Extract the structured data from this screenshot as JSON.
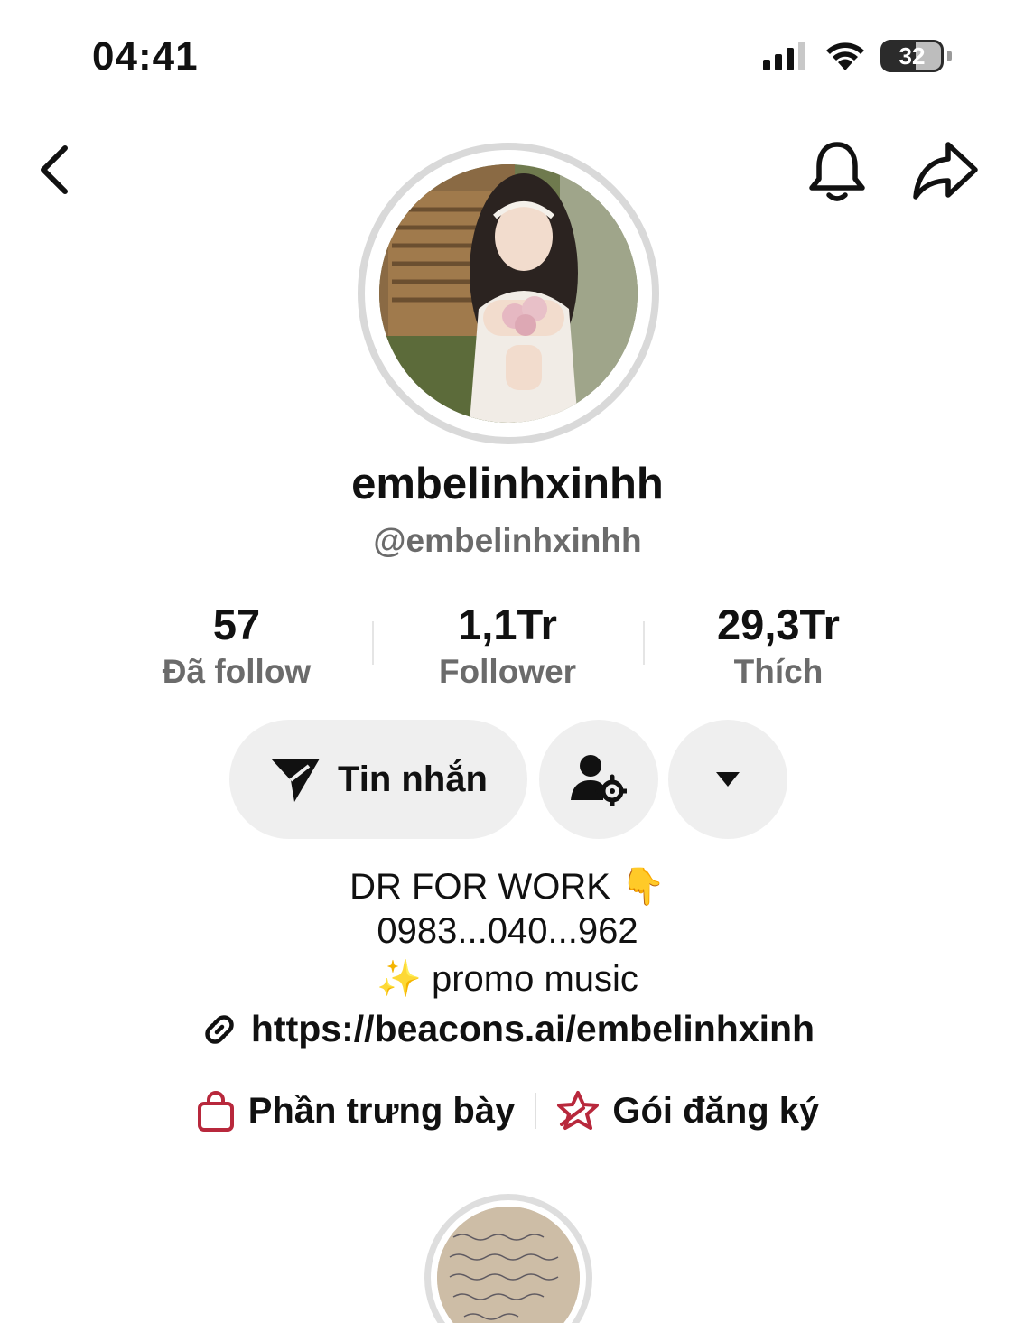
{
  "status_bar": {
    "time": "04:41",
    "battery": "32",
    "icons": [
      "signal-icon",
      "wifi-icon",
      "battery-icon"
    ]
  },
  "nav": {
    "back_icon": "chevron-left-icon",
    "bell_icon": "bell-icon",
    "share_icon": "share-icon"
  },
  "profile": {
    "display_name": "embelinhxinhh",
    "handle": "@embelinhxinhh"
  },
  "stats": [
    {
      "value": "57",
      "label": "Đã follow"
    },
    {
      "value": "1,1Tr",
      "label": "Follower"
    },
    {
      "value": "29,3Tr",
      "label": "Thích"
    }
  ],
  "actions": {
    "message_label": "Tin nhắn",
    "message_icon": "send-icon",
    "user_settings_icon": "user-gear-icon",
    "more_icon": "caret-down-icon"
  },
  "bio": {
    "line1": "DR FOR WORK  👇",
    "line2": " 0983...040...962",
    "line3": "✨ promo music",
    "link": "https://beacons.ai/embelinhxinh"
  },
  "features": {
    "showcase_label": "Phần trưng bày",
    "subscription_label": "Gói đăng ký"
  },
  "colors": {
    "accent": "#b8283c",
    "muted_text": "#6b6b6b",
    "button_bg": "#efefef"
  }
}
